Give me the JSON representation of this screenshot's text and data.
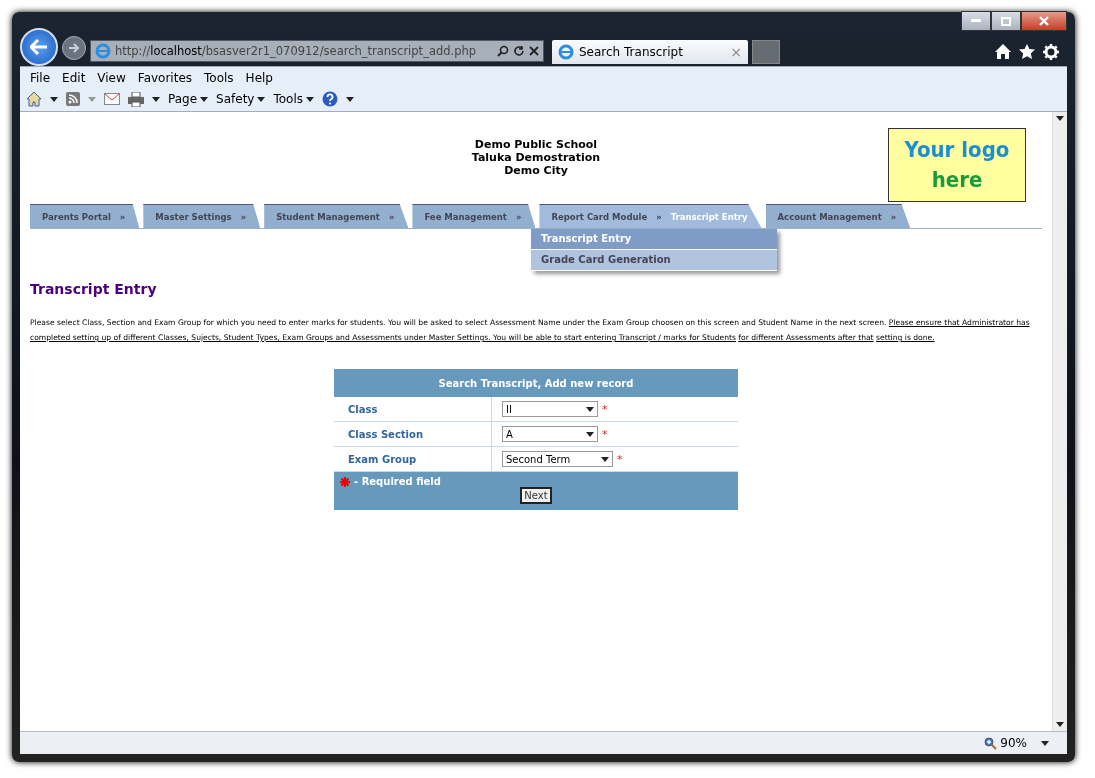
{
  "browser": {
    "address": {
      "scheme": "http://",
      "host": "localhost",
      "path": "/bsasver2r1_070912/search_transcript_add.php"
    },
    "tab": {
      "title": "Search Transcript",
      "close": "×"
    },
    "menu": [
      "File",
      "Edit",
      "View",
      "Favorites",
      "Tools",
      "Help"
    ],
    "commands": [
      "Page",
      "Safety",
      "Tools"
    ],
    "zoom": "90%"
  },
  "school": {
    "lines": [
      "Demo Public School",
      "Taluka Demostration",
      "Demo City"
    ],
    "logo": [
      "Your logo",
      "here"
    ]
  },
  "nav": [
    {
      "label": "Parents Portal",
      "arrow": "»",
      "selected": false
    },
    {
      "label": "Master Settings",
      "arrow": "»",
      "selected": false
    },
    {
      "label": "Student Management",
      "arrow": "»",
      "selected": false
    },
    {
      "label": "Fee Management",
      "arrow": "»",
      "selected": false
    },
    {
      "label": "Report Card Module",
      "arrow": "»",
      "current": "Transcript Entry",
      "selected": true
    },
    {
      "label": "Account Management",
      "arrow": "»",
      "selected": false
    }
  ],
  "submenu": [
    {
      "label": "Transcript Entry",
      "selected": true
    },
    {
      "label": "Grade Card Generation",
      "selected": false
    }
  ],
  "page_title": "Transcript Entry",
  "intro": [
    {
      "text": "Please select Class, Section and Exam Group for which you need to enter marks for students. You will be asked to select Assessment Name under the Exam Group choosen on this screen and Student Name in the next screen.",
      "underlined": false
    },
    {
      "text": "Please ensure that Administrator has completed setting up of different Classes, Sujects, Student Types, Exam Groups and Assessments under Master Settings. You will be able to start entering Transcript / marks for Students",
      "underlined": true
    },
    {
      "text": "for different Assessments after that",
      "underlined": true
    },
    {
      "text": "setting is done.",
      "underlined": true
    }
  ],
  "form": {
    "title": "Search Transcript, Add new record",
    "fields": [
      {
        "label": "Class",
        "value": "II",
        "required": true,
        "wide": false
      },
      {
        "label": "Class Section",
        "value": "A",
        "required": true,
        "wide": false
      },
      {
        "label": "Exam Group",
        "value": "Second Term",
        "required": true,
        "wide": true
      }
    ],
    "required_mark": "*",
    "required_note": "- Required field",
    "button": "Next"
  }
}
